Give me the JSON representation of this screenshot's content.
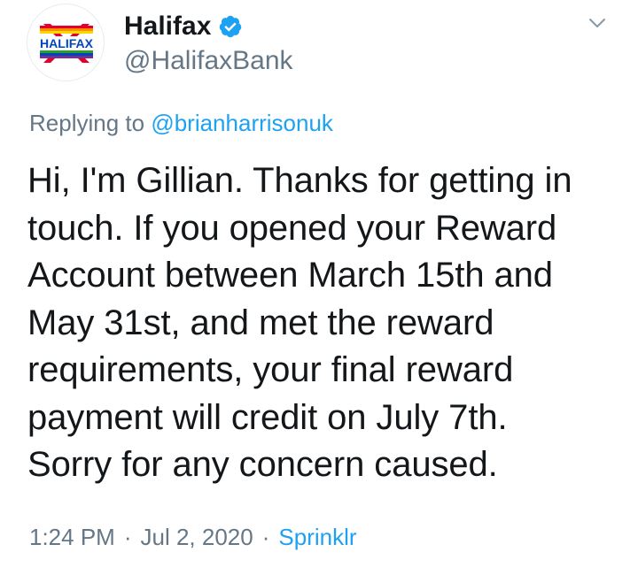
{
  "tweet": {
    "author": {
      "name": "Halifax",
      "handle": "@HalifaxBank",
      "verified": true,
      "avatar_text": "HALIFAX"
    },
    "reply": {
      "prefix": "Replying to ",
      "mention": "@brianharrisonuk"
    },
    "text": "Hi, I'm Gillian. Thanks for getting in\ntouch. If you opened your Reward\nAccount between March 15th and\nMay 31st, and met the reward\nrequirements, your final reward\npayment will credit on July 7th.\nSorry for any concern caused.",
    "meta": {
      "time": "1:24 PM",
      "separator": "·",
      "date": "Jul 2, 2020",
      "source": "Sprinklr"
    },
    "icons": {
      "verified": "verified-badge-icon",
      "menu": "chevron-down-icon"
    },
    "colors": {
      "link": "#1da1f2",
      "muted": "#657786",
      "text": "#14171a",
      "logo_red": "#e4002b",
      "logo_blue": "#0047bb"
    }
  }
}
